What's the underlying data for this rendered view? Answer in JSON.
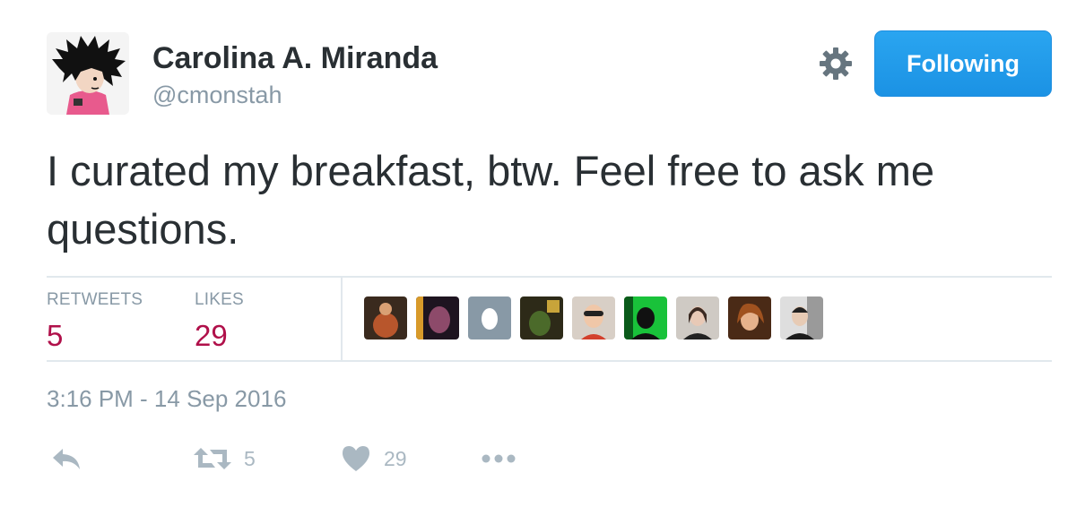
{
  "user": {
    "name": "Carolina A. Miranda",
    "handle": "@cmonstah",
    "follow_label": "Following"
  },
  "tweet": {
    "text": "I curated my breakfast, btw. Feel free to ask me questions."
  },
  "stats": {
    "retweets_label": "RETWEETS",
    "retweets_count": "5",
    "likes_label": "LIKES",
    "likes_count": "29"
  },
  "likers_count_shown": 9,
  "timestamp": "3:16 PM - 14 Sep 2016",
  "actions": {
    "retweet_count": "5",
    "like_count": "29"
  },
  "colors": {
    "follow_button": "#1b92e4",
    "stat_count": "#b0104a",
    "muted_text": "#8899a6",
    "icon_gray": "#aab8c2",
    "divider": "#e1e8ed"
  },
  "icons": [
    "gear-icon",
    "reply-icon",
    "retweet-icon",
    "heart-icon",
    "more-icon"
  ]
}
